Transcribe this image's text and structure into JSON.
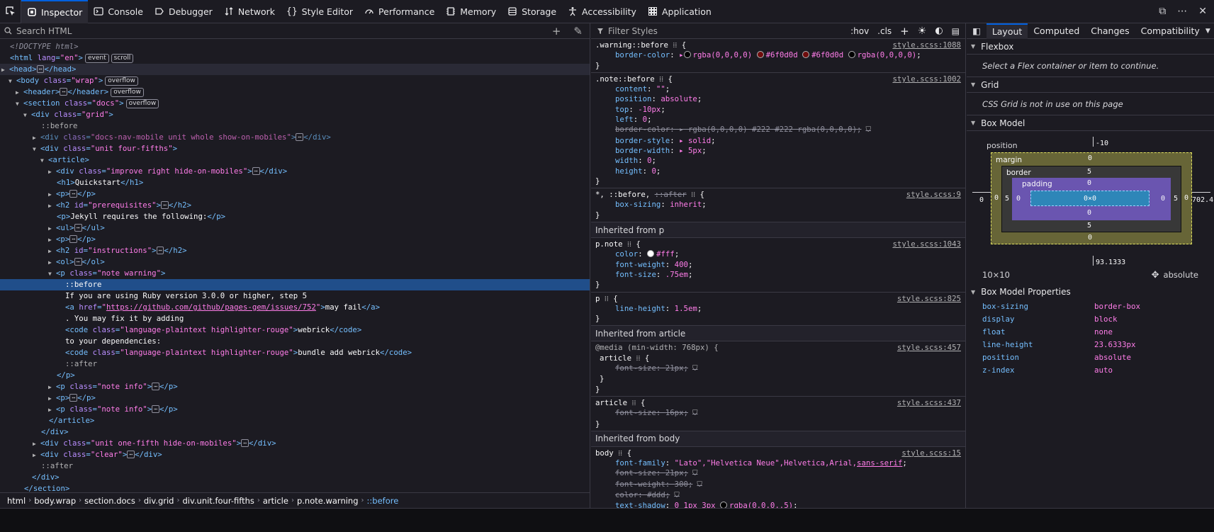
{
  "toolbar": {
    "tabs": [
      {
        "label": "Inspector",
        "icon": "inspector-icon"
      },
      {
        "label": "Console",
        "icon": "console-icon"
      },
      {
        "label": "Debugger",
        "icon": "debugger-icon"
      },
      {
        "label": "Network",
        "icon": "network-icon"
      },
      {
        "label": "Style Editor",
        "icon": "braces-icon"
      },
      {
        "label": "Performance",
        "icon": "performance-icon"
      },
      {
        "label": "Memory",
        "icon": "memory-icon"
      },
      {
        "label": "Storage",
        "icon": "storage-icon"
      },
      {
        "label": "Accessibility",
        "icon": "accessibility-icon"
      },
      {
        "label": "Application",
        "icon": "application-icon"
      }
    ]
  },
  "markup": {
    "search_placeholder": "Search HTML",
    "breadcrumbs": [
      "html",
      "body.wrap",
      "section.docs",
      "div.grid",
      "div.unit.four-fifths",
      "article",
      "p.note.warning",
      "::before"
    ]
  },
  "rules": {
    "filter_placeholder": "Filter Styles",
    "hov": ":hov",
    "cls": ".cls",
    "inherited_p": "Inherited from p",
    "inherited_article": "Inherited from article",
    "inherited_body": "Inherited from body",
    "colors": {
      "dark_red": "#6f0d0d",
      "white": "#ffffff"
    }
  },
  "layout": {
    "tabs": [
      "Layout",
      "Computed",
      "Changes",
      "Compatibility"
    ],
    "flexbox_title": "Flexbox",
    "flexbox_msg": "Select a Flex container or item to continue.",
    "grid_title": "Grid",
    "grid_msg": "CSS Grid is not in use on this page",
    "boxmodel_title": "Box Model",
    "boxmodel": {
      "position_label": "position",
      "top": "-10",
      "left": "0",
      "right": "702.4",
      "bottom": "93.1333",
      "margin_label": "margin",
      "border_label": "border",
      "padding_label": "padding",
      "content": "0×0",
      "margin": {
        "top": "0",
        "right": "0",
        "bottom": "0",
        "left": "0"
      },
      "border": {
        "top": "5",
        "right": "5",
        "bottom": "5",
        "left": "5"
      },
      "padding": {
        "top": "0",
        "right": "0",
        "bottom": "0",
        "left": "0"
      },
      "size": "10×10",
      "position_value": "absolute"
    },
    "props_title": "Box Model Properties",
    "props": [
      {
        "k": "box-sizing",
        "v": "border-box"
      },
      {
        "k": "display",
        "v": "block"
      },
      {
        "k": "float",
        "v": "none"
      },
      {
        "k": "line-height",
        "v": "23.6333px"
      },
      {
        "k": "position",
        "v": "absolute"
      },
      {
        "k": "z-index",
        "v": "auto"
      }
    ]
  }
}
